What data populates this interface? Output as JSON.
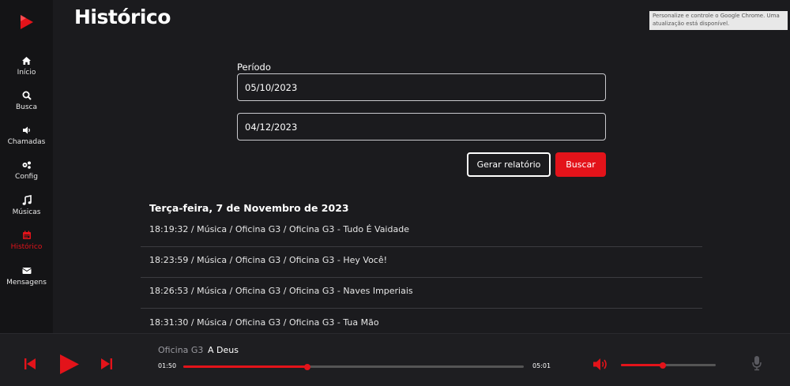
{
  "page": {
    "title": "Histórico"
  },
  "chrome_notice": "Personalize e controle o Google Chrome. Uma atualização está disponível.",
  "sidebar": {
    "items": [
      {
        "label": "Início",
        "icon": "home-icon"
      },
      {
        "label": "Busca",
        "icon": "search-icon"
      },
      {
        "label": "Chamadas",
        "icon": "speaker-icon"
      },
      {
        "label": "Config",
        "icon": "gears-icon"
      },
      {
        "label": "Músicas",
        "icon": "music-note-icon"
      },
      {
        "label": "Histórico",
        "icon": "calendar-icon",
        "active": true
      },
      {
        "label": "Mensagens",
        "icon": "envelope-icon"
      }
    ]
  },
  "filter": {
    "period_label": "Período",
    "start_date": "05/10/2023",
    "end_date": "04/12/2023",
    "report_button": "Gerar relatório",
    "search_button": "Buscar"
  },
  "history": {
    "day": "Terça-feira, 7 de Novembro de 2023",
    "entries": [
      "18:19:32 / Música / Oficina G3 / Oficina G3 - Tudo É Vaidade",
      "18:23:59 / Música / Oficina G3 / Oficina G3 - Hey Você!",
      "18:26:53 / Música / Oficina G3 / Oficina G3 - Naves Imperiais",
      "18:31:30 / Música / Oficina G3 / Oficina G3 - Tua Mão"
    ]
  },
  "player": {
    "artist": "Oficina G3",
    "song": "A Deus",
    "elapsed": "01:50",
    "duration": "05:01",
    "progress_fraction": 0.365,
    "volume_fraction": 0.44
  },
  "colors": {
    "accent": "#e3131a",
    "background": "#1b1b1e",
    "sidebar": "#141416"
  }
}
